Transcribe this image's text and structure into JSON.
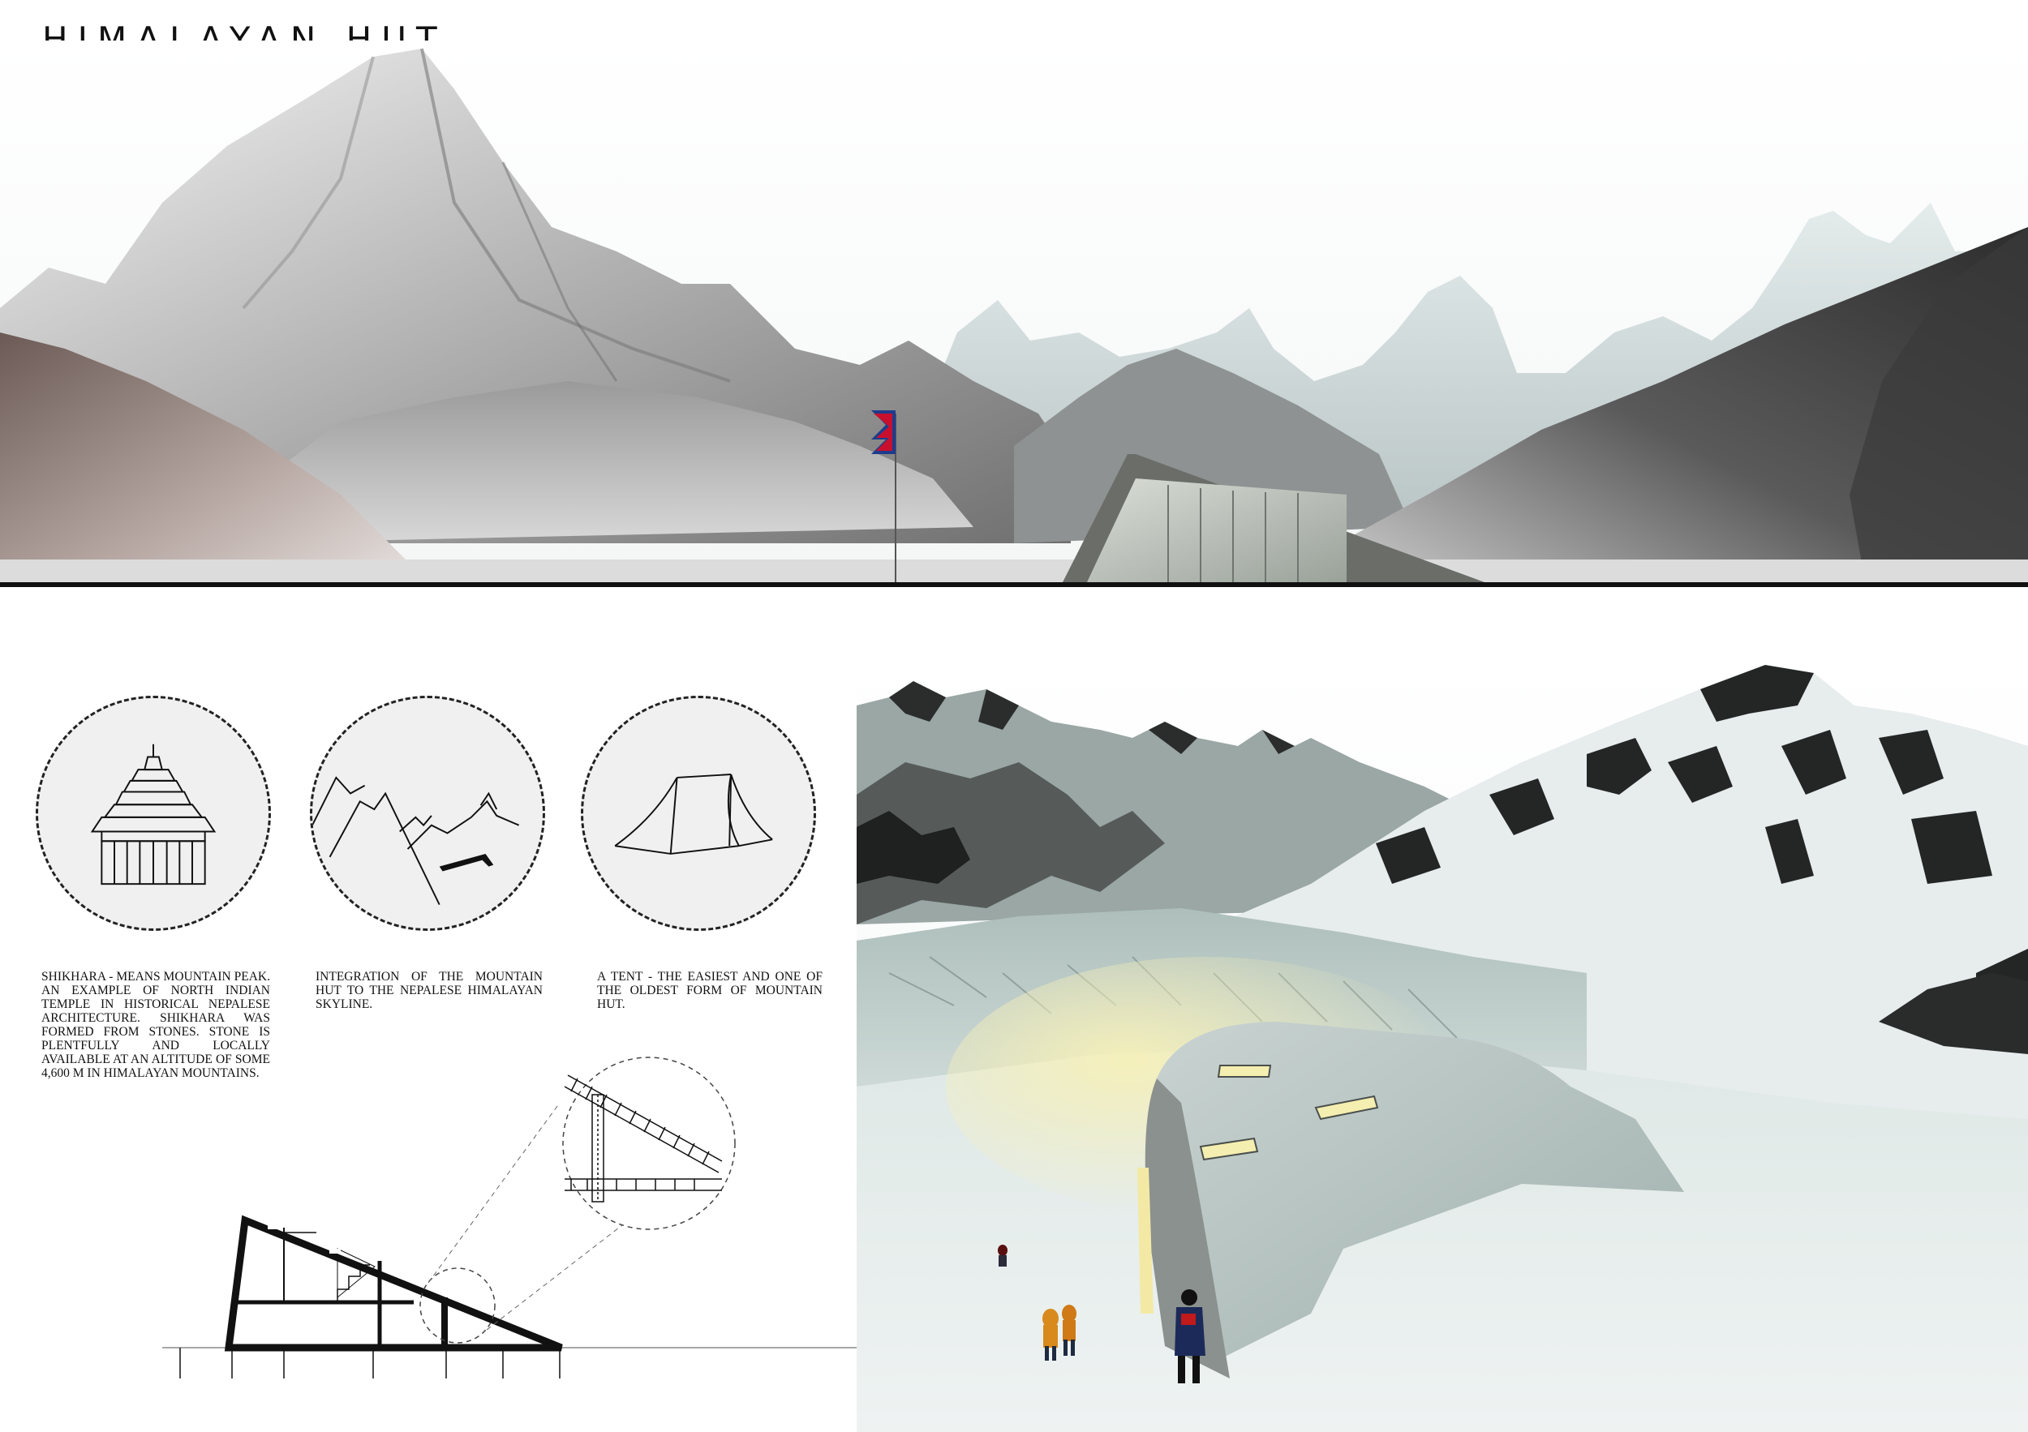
{
  "page": {
    "title": "HIMALAYAN HUT"
  },
  "concepts": [
    {
      "icon": "shikhara-temple-icon",
      "caption": "SHIKHARA - MEANS MOUNTAIN PEAK. AN EXAMPLE OF NORTH INDIAN TEMPLE IN HISTORICAL NEPALESE ARCHITECTURE. SHIKHARA WAS FORMED FROM STONES. STONE IS PLENTFULLY AND LOCALLY AVAILABLE AT AN ALTITUDE OF SOME 4,600 M IN HIMALAYAN MOUNTAINS."
    },
    {
      "icon": "mountain-skyline-icon",
      "caption": "INTEGRATION OF THE MOUNTAIN HUT TO THE NEPALESE HIMALAYAN SKYLINE."
    },
    {
      "icon": "tent-icon",
      "caption": "A TENT - THE EASIEST AND ONE OF THE OLDEST FORM OF MOUNTAIN HUT."
    }
  ],
  "colors": {
    "flag_red": "#c8102e",
    "flag_blue": "#1e3c8c",
    "rule_dark": "#111111",
    "snow": "#e9efee",
    "window_glow": "#f4eeb0"
  }
}
